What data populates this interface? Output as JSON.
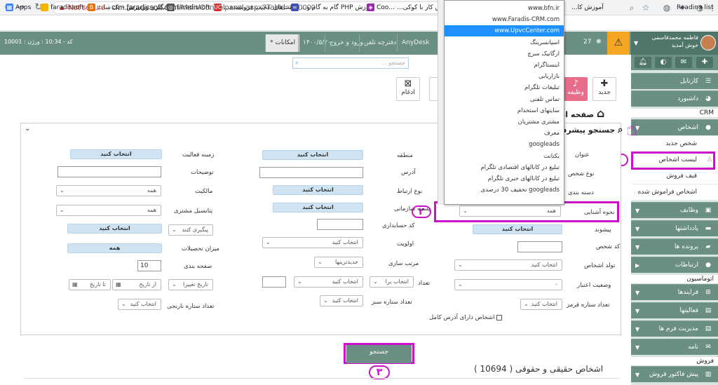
{
  "browser": {
    "security_label": "Not secure",
    "url_host": "crm.faradissoft.com",
    "url_path": "/Main/Controlpanel.aspx?TabId=020000",
    "bookmarks": [
      {
        "label": "Apps"
      },
      {
        "label": "faradissoft"
      },
      {
        "label": "بانگیری وردپرس - یک سا..."
      },
      {
        "label": "faradissoft"
      },
      {
        "label": "قیمت‌های عجیب فروشنده..."
      },
      {
        "label": "آموزش PHP گام به گام و..."
      },
      {
        "label": "Coo..."
      },
      {
        "label": "آموزش کار با کوکی..."
      },
      {
        "label": "آموزش کا..."
      }
    ],
    "reading_list": "Reading list"
  },
  "topbar": {
    "left_info": "10001 : کد - 10:34 : ورژن",
    "tabs": [
      "* امکانات",
      "۱۴۰۰/۵/۲۰",
      "ورود و خروج",
      "دفترچه تلفن",
      "AnyDesk"
    ],
    "badge_count": "27",
    "user_name": "فاطمه محمدقاسمی",
    "welcome": "خوش آمدید"
  },
  "sidebar": {
    "items": [
      {
        "label": "کارتابل",
        "icon": "list-icon"
      },
      {
        "label": "داشبورد",
        "icon": "dashboard-icon"
      }
    ],
    "crm_label": "CRM",
    "persons_label": "اشخاص",
    "persons_sub": [
      "شخص جدید",
      "لیست اشخاص",
      "قیف فروش",
      "اشخاص فراموش شده"
    ],
    "sections": [
      {
        "label": "وظایف"
      },
      {
        "label": "یادداشتها"
      },
      {
        "label": "پرونده ها"
      },
      {
        "label": "ارتباطات"
      }
    ],
    "automation_label": "اتوماسیون",
    "auto_items": [
      {
        "label": "فرایندها"
      },
      {
        "label": "فعالیتها"
      },
      {
        "label": "مدیریت فرم ها"
      },
      {
        "label": "نامه"
      }
    ],
    "sales_label": "فروش",
    "sales_items": [
      {
        "label": "پیش فاکتور فروش"
      }
    ]
  },
  "main": {
    "search_placeholder": "جستجو ...",
    "btn_new": "جدید",
    "btn_task": "وظیفه",
    "btn_merge": "ادغام",
    "breadcrumb_home": "صفحه اصلی",
    "panel_title": "جستجو پیشرفته",
    "col1": {
      "title_label": "عنوان",
      "person_type_label": "نوع شخص",
      "category_label": "دسته بندی",
      "acquaint_label": "نحوه آشنایی",
      "acquaint_value": "همه",
      "prefix_label": "پیشوند",
      "prefix_value": "انتخاب کنید",
      "person_code_label": "کد شخص",
      "birth_label": "تولد اشخاص",
      "birth_value": "انتخاب کنید",
      "credit_label": "وضعیت اعتبار",
      "credit_value": "-",
      "red_stars_label": "تعداد ستاره قرمز",
      "red_stars_value": "انتخاب کنید",
      "full_address_label": "اشخاص دارای آدرس کامل"
    },
    "col2": {
      "region_label": "منطقه",
      "region_value": "انتخاب کنید",
      "address_label": "آدرس",
      "relation_label": "نوع ارتباط",
      "relation_value": "انتخاب کنید",
      "org_post_label": "پست سازمانی",
      "org_post_value": "انتخاب کنید",
      "accounting_label": "کد حسابداری",
      "priority_label": "اولویت",
      "priority_value": "انتخاب کنید",
      "sort_label": "مرتب سازی",
      "sort_value": "جدیدترینها",
      "count_label": "تعداد",
      "count_value_a": "انتخاب برا",
      "count_value_b": "انتخاب کنید",
      "green_stars_label": "تعداد ستاره سبز",
      "green_stars_value": "انتخاب کنید"
    },
    "col3": {
      "activity_label": "زمینه فعالیت",
      "activity_value": "انتخاب کنید",
      "desc_label": "توضیحات",
      "ownership_label": "مالکیت",
      "ownership_value": "همه",
      "potential_label": "پتانسیل مشتری",
      "potential_value": "همه",
      "follow_value": "پیگیری کنند",
      "follow_btn": "انتخاب کنید",
      "education_label": "میزان تحصیلات",
      "education_value": "همه",
      "page_rows_label": "صفحه بندی",
      "page_rows_value": "10",
      "date_change_label": "تاریخ تغییرا",
      "date_from": "از تاریخ",
      "date_to": "تا تاریخ",
      "orange_stars_label": "تعداد ستاره نارنجی",
      "orange_stars_value": "انتخاب کنید"
    },
    "search_button": "جستجو",
    "result_title": "اشخاص حقیقی و حقوقی ( 10694 )"
  },
  "dropdown": {
    "options": [
      "www.bfn.ir",
      "www.Faradis-CRM.com",
      "www.UpvcCenter.com",
      "اسپانسرینگ",
      "ارگانیک سرچ",
      "اینستاگرام",
      "بازاریابی",
      "تبلیغات تلگرام",
      "تماس تلفنی",
      "سایتهای استخدام",
      "مشتری مشتریان",
      "معرف",
      "googleads",
      "یکتانت",
      "تبلیغ در کانالهای اقتصادی تلگرام",
      "تبلیغ در کانالهای خبری تلگرام",
      "googleads تخفیف 30 درصدی"
    ],
    "selected_index": 2
  },
  "annotations": {
    "callout_1": "۱",
    "callout_2": "۲",
    "callout_3": "۳"
  },
  "colors": {
    "brand": "#6b8f84",
    "highlight": "#cc11cc",
    "selected": "#1e90ff",
    "warning": "#f5a623"
  }
}
